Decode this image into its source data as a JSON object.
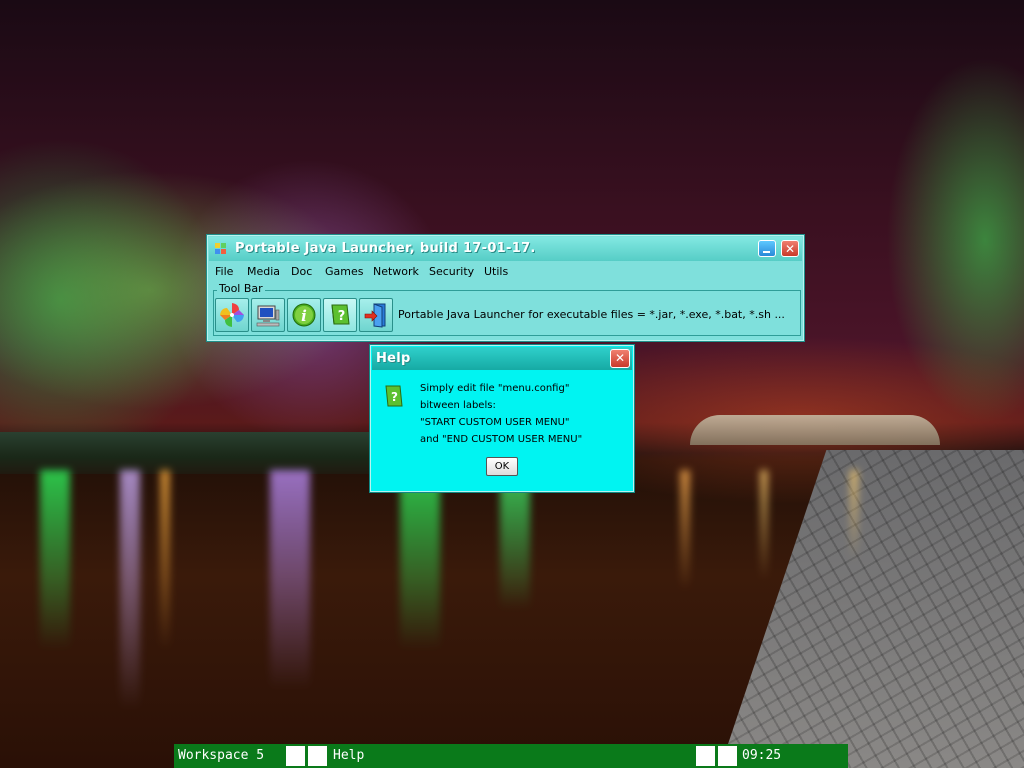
{
  "launcher_window": {
    "title": "Portable Java Launcher, build 17-01-17.",
    "menu": [
      "File",
      "Media",
      "Doc",
      "Games",
      "Network",
      "Security",
      "Utils"
    ],
    "toolbar": {
      "legend": "Tool Bar",
      "tools": [
        {
          "icon": "pinwheel-icon"
        },
        {
          "icon": "computer-icon"
        },
        {
          "icon": "info-icon"
        },
        {
          "icon": "help-icon"
        },
        {
          "icon": "exit-door-icon"
        }
      ],
      "description": "Portable Java Launcher for executable files = *.jar, *.exe, *.bat, *.sh ..."
    }
  },
  "help_dialog": {
    "title": "Help",
    "icon": "help-icon",
    "lines": [
      "Simply edit file \"menu.config\"",
      "bitween labels:",
      "\"START CUSTOM USER MENU\"",
      "and \"END CUSTOM USER MENU\""
    ],
    "ok_label": "OK"
  },
  "taskbar": {
    "workspace": "Workspace 5",
    "task": "Help",
    "clock": "09:25"
  },
  "colors": {
    "window_bg": "#7fe0dc",
    "dialog_bg": "#00f4f2",
    "taskbar_bg": "#0a7a1a"
  }
}
